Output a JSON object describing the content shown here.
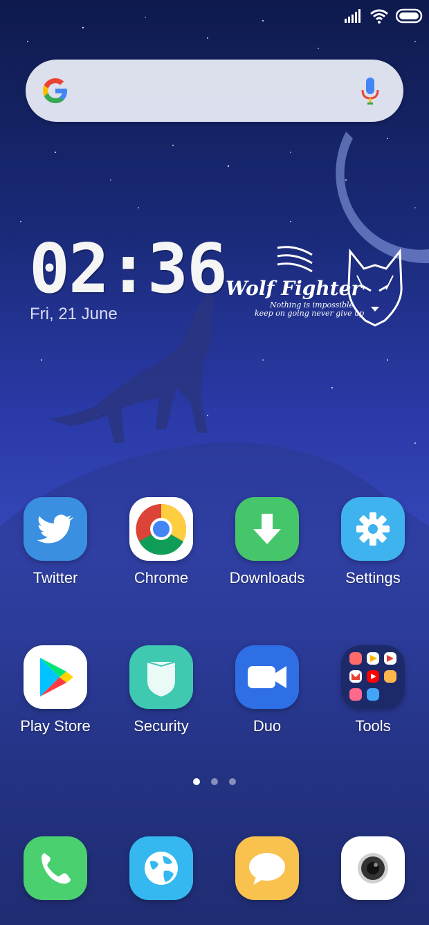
{
  "status_bar": {
    "icons": [
      "signal-icon",
      "wifi-icon",
      "battery-icon"
    ]
  },
  "search": {
    "icons": [
      "google-logo-icon",
      "mic-icon"
    ]
  },
  "clock_widget": {
    "time": "02:36",
    "date": "Fri, 21 June"
  },
  "wallpaper_brand": {
    "title": "Wolf Fighter",
    "line1": "Nothing is impossible",
    "line2": "keep on going never give up"
  },
  "home_apps": [
    {
      "label": "Twitter",
      "icon": "twitter-icon",
      "color": "#3a8fe0"
    },
    {
      "label": "Chrome",
      "icon": "chrome-icon",
      "color": "#ffffff"
    },
    {
      "label": "Downloads",
      "icon": "download-icon",
      "color": "#46c66a"
    },
    {
      "label": "Settings",
      "icon": "gear-icon",
      "color": "#3fb3ee"
    },
    {
      "label": "Play Store",
      "icon": "play-store-icon",
      "color": "#ffffff"
    },
    {
      "label": "Security",
      "icon": "shield-icon",
      "color": "#3ec9b0"
    },
    {
      "label": "Duo",
      "icon": "video-camera-icon",
      "color": "#2e6fe5"
    },
    {
      "label": "Tools",
      "icon": "folder-icon",
      "color": "#1c2a6a"
    }
  ],
  "pager": {
    "pages": 3,
    "current": 1
  },
  "dock": [
    {
      "icon": "phone-icon",
      "color": "#4bd070"
    },
    {
      "icon": "browser-globe-icon",
      "color": "#34b8ef"
    },
    {
      "icon": "message-icon",
      "color": "#f9c24f"
    },
    {
      "icon": "camera-icon",
      "color": "#ffffff"
    }
  ]
}
